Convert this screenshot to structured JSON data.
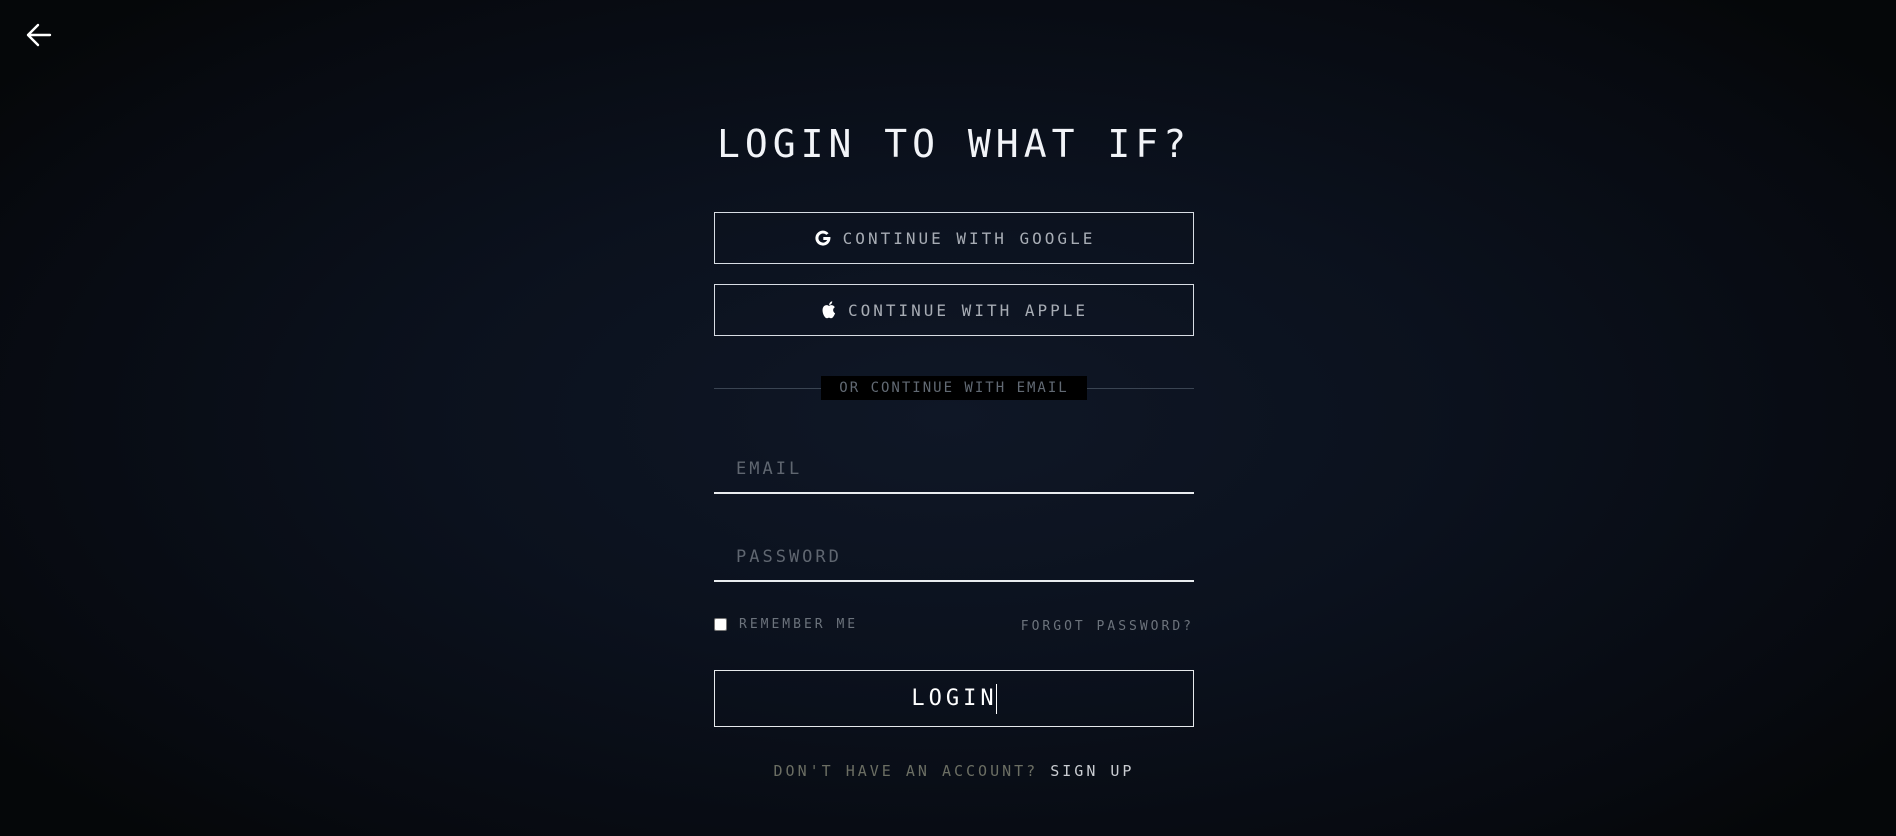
{
  "header": {
    "back_icon": "arrow-left-icon"
  },
  "login": {
    "title": "LOGIN TO WHAT IF?",
    "google_label": "CONTINUE WITH GOOGLE",
    "google_icon": "google-icon",
    "apple_label": "CONTINUE WITH APPLE",
    "apple_icon": "apple-icon",
    "divider_text": "OR CONTINUE WITH EMAIL",
    "email_placeholder": "EMAIL",
    "email_value": "",
    "password_placeholder": "PASSWORD",
    "password_value": "",
    "remember_label": "REMEMBER ME",
    "remember_checked": false,
    "forgot_label": "FORGOT PASSWORD?",
    "login_label": "LOGIN",
    "signup_prompt": "DON'T HAVE AN ACCOUNT? ",
    "signup_link": "SIGN UP"
  },
  "colors": {
    "background": "#0b111d",
    "text": "#ffffff",
    "muted": "#6c737c"
  }
}
